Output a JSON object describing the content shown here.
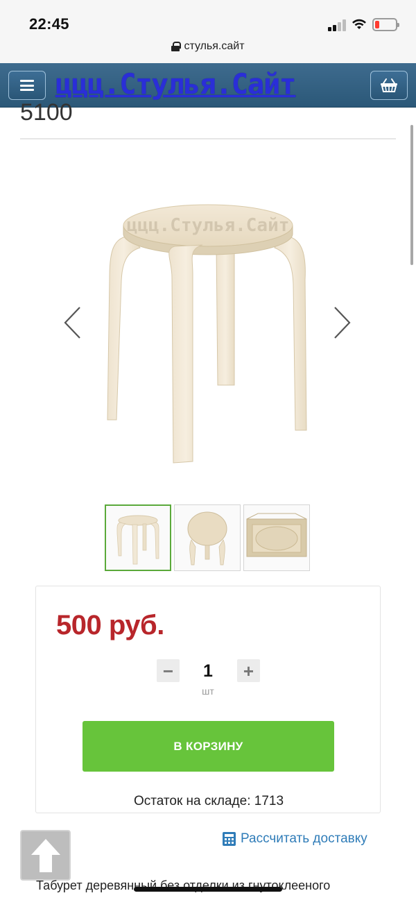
{
  "status_bar": {
    "time": "22:45"
  },
  "url_bar": {
    "domain": "стулья.сайт"
  },
  "header": {
    "logo_text": "ццц.Стулья.Сайт",
    "menu_icon": "hamburger-icon",
    "cart_icon": "basket-icon"
  },
  "product": {
    "article_code": "5100",
    "watermark": "ццц.Стулья.Сайт",
    "thumbnails": [
      "stool-front",
      "stool-top",
      "stool-packed"
    ]
  },
  "buy_box": {
    "price": "500 руб.",
    "quantity": "1",
    "quantity_unit": "шт",
    "minus_label": "−",
    "plus_label": "+",
    "add_to_cart_label": "В КОРЗИНУ",
    "stock_text": "Остаток на складе: 1713"
  },
  "delivery": {
    "link_label": "Рассчитать доставку"
  },
  "description": {
    "text": "Табурет деревянный без отделки из гнутоклееного"
  },
  "colors": {
    "header_blue": "#2f5c7e",
    "price_red": "#b8262b",
    "cart_green": "#67c43b",
    "link_blue": "#2f7cb8",
    "logo_blue": "#2a2ed8"
  }
}
